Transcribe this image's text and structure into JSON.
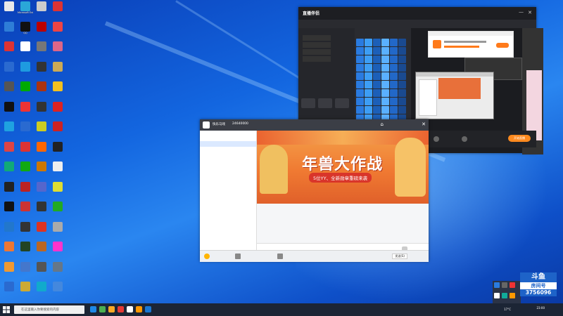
{
  "desktop_icons": [
    {
      "label": "",
      "color": "#e8e8e8"
    },
    {
      "label": "Microsoft Edge",
      "color": "#2aa7d8"
    },
    {
      "label": "",
      "color": "#ccc"
    },
    {
      "label": "",
      "color": "#d33"
    },
    {
      "label": "",
      "color": "#2e7dd7"
    },
    {
      "label": "QQ",
      "color": "#111"
    },
    {
      "label": "",
      "color": "#b00"
    },
    {
      "label": "",
      "color": "#e44"
    },
    {
      "label": "",
      "color": "#d33"
    },
    {
      "label": "",
      "color": "#fff"
    },
    {
      "label": "",
      "color": "#777"
    },
    {
      "label": "",
      "color": "#d68"
    },
    {
      "label": "",
      "color": "#2a6ad0"
    },
    {
      "label": "",
      "color": "#1e9be0"
    },
    {
      "label": "",
      "color": "#333"
    },
    {
      "label": "",
      "color": "#ca5"
    },
    {
      "label": "",
      "color": "#555"
    },
    {
      "label": "",
      "color": "#0a0"
    },
    {
      "label": "",
      "color": "#a31"
    },
    {
      "label": "",
      "color": "#f3c020"
    },
    {
      "label": "",
      "color": "#111"
    },
    {
      "label": "",
      "color": "#e33"
    },
    {
      "label": "",
      "color": "#333"
    },
    {
      "label": "",
      "color": "#d22"
    },
    {
      "label": "",
      "color": "#1fa2e0"
    },
    {
      "label": "",
      "color": "#2a6ad0"
    },
    {
      "label": "",
      "color": "#cc2"
    },
    {
      "label": "",
      "color": "#c22"
    },
    {
      "label": "",
      "color": "#d44"
    },
    {
      "label": "",
      "color": "#d33"
    },
    {
      "label": "",
      "color": "#f60"
    },
    {
      "label": "",
      "color": "#222"
    },
    {
      "label": "",
      "color": "#1a7"
    },
    {
      "label": "",
      "color": "#1a1"
    },
    {
      "label": "",
      "color": "#c70"
    },
    {
      "label": "",
      "color": "#eee"
    },
    {
      "label": "",
      "color": "#222"
    },
    {
      "label": "",
      "color": "#b22"
    },
    {
      "label": "",
      "color": "#56c"
    },
    {
      "label": "",
      "color": "#dd3"
    },
    {
      "label": "",
      "color": "#111"
    },
    {
      "label": "",
      "color": "#c33"
    },
    {
      "label": "",
      "color": "#333"
    },
    {
      "label": "",
      "color": "#2a2"
    },
    {
      "label": "",
      "color": "#27c"
    },
    {
      "label": "",
      "color": "#333"
    },
    {
      "label": "",
      "color": "#d32"
    },
    {
      "label": "",
      "color": "#aaa"
    },
    {
      "label": "",
      "color": "#e73"
    },
    {
      "label": "",
      "color": "#242"
    },
    {
      "label": "",
      "color": "#b62"
    },
    {
      "label": "",
      "color": "#f3c"
    },
    {
      "label": "",
      "color": "#e93"
    },
    {
      "label": "",
      "color": "#47c"
    },
    {
      "label": "",
      "color": "#555"
    },
    {
      "label": "",
      "color": "#678"
    },
    {
      "label": "",
      "color": "#2a6ad0"
    },
    {
      "label": "",
      "color": "#ca3"
    },
    {
      "label": "",
      "color": "#1ac"
    },
    {
      "label": "",
      "color": "#48d"
    }
  ],
  "taskbar": {
    "search_placeholder": "在这里输入你要搜索的内容",
    "apps": [
      "#1e88e5",
      "#4caf50",
      "#f9a825",
      "#e53935",
      "#ffffff",
      "#ff9800",
      "#1976d2"
    ],
    "clock": "23:00",
    "weather": "17°C"
  },
  "live_helper": {
    "logo": "直播伴侣",
    "tabs": [
      "",
      "",
      ""
    ],
    "start_live": "开始直播"
  },
  "yy": {
    "title": "快乐马戏",
    "channel_id": "24640000",
    "banner_title": "年兽大作战",
    "banner_sub": "5位YY、全新勋章重磅来袭",
    "list": [
      "",
      "",
      "",
      "",
      "",
      "",
      "",
      "",
      "",
      "",
      "",
      "",
      "",
      "",
      "",
      "",
      "",
      "",
      "",
      "",
      "",
      ""
    ],
    "messages": [
      "",
      "",
      "",
      "",
      ""
    ],
    "send": "发送(S)"
  },
  "douyu": {
    "brand": "斗鱼",
    "room_label": "房间号",
    "room_number": "3756096"
  }
}
